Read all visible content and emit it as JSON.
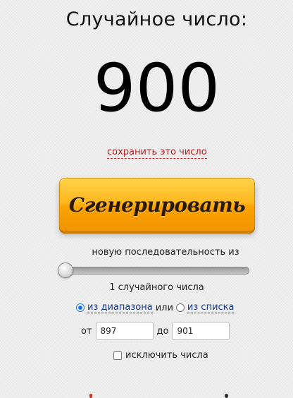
{
  "header": {
    "title": "Случайное число:"
  },
  "result": {
    "number": "900"
  },
  "save_link": {
    "label": "сохранить это число"
  },
  "generate_button": {
    "label": "Сгенерировать"
  },
  "sequence": {
    "label": "новую последовательность из",
    "slider_value": 1,
    "count_label": "1 случайного числа"
  },
  "mode": {
    "options": [
      {
        "label": "из диапазона",
        "selected": true
      },
      {
        "label": "из списка",
        "selected": false
      }
    ],
    "separator": "или"
  },
  "range": {
    "from_label": "от",
    "from_value": "897",
    "to_label": "до",
    "to_value": "901"
  },
  "exclude": {
    "label": "исключить числа",
    "checked": false
  },
  "colors": {
    "button": "#ffb81f",
    "link": "#b22222",
    "radio": "#1a73e8"
  }
}
